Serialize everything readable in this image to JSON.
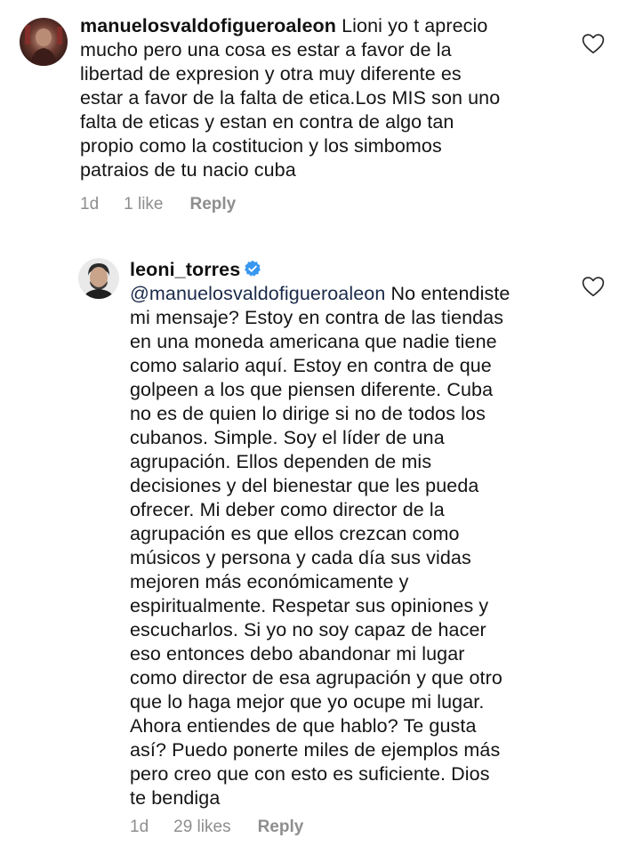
{
  "comments": [
    {
      "username": "manuelosvaldofigueroaleon",
      "lines_first_rest": " Lioni yo t aprecio",
      "lines": [
        "mucho pero una cosa es estar a favor de la",
        "libertad de expresion y otra muy diferente es",
        "estar a favor de la falta de etica.Los MIS son uno",
        "falta de eticas y estan en contra de algo tan",
        "propio como la costitucion y los simbomos",
        "patraios de tu nacio  cuba"
      ],
      "time": "1d",
      "likes": "1 like",
      "reply_label": "Reply"
    },
    {
      "username": "leoni_torres",
      "verified": true,
      "mention": "@manuelosvaldofigueroaleon",
      "mention_rest": " No entendiste",
      "lines": [
        "mi mensaje? Estoy en contra de las tiendas",
        "en una moneda americana que nadie tiene",
        "como salario aquí. Estoy en contra de que",
        "golpeen a los que piensen diferente. Cuba",
        "no es de quien lo dirige si no de todos los",
        "cubanos. Simple. Soy el líder de una",
        "agrupación.  Ellos dependen de mis",
        "decisiones y del bienestar que les pueda",
        "ofrecer. Mi deber como director de la",
        "agrupación es que ellos crezcan como",
        "músicos y persona y cada día sus vidas",
        "mejoren más económicamente y",
        "espiritualmente. Respetar sus opiniones y",
        "escucharlos. Si yo no soy capaz de hacer",
        "eso entonces debo abandonar mi lugar",
        "como director de esa agrupación y que otro",
        "que lo haga mejor que yo ocupe mi lugar.",
        "Ahora entiendes de que hablo? Te gusta",
        "así? Puedo ponerte miles de ejemplos más",
        "pero creo que con esto es suficiente. Dios",
        "te bendiga"
      ],
      "time": "1d",
      "likes": "29 likes",
      "reply_label": "Reply"
    }
  ],
  "icons": {
    "like": "heart-outline-icon",
    "verified": "verified-badge-icon"
  },
  "colors": {
    "text": "#141414",
    "meta": "#8e8e8e",
    "verified": "#3897f0"
  }
}
